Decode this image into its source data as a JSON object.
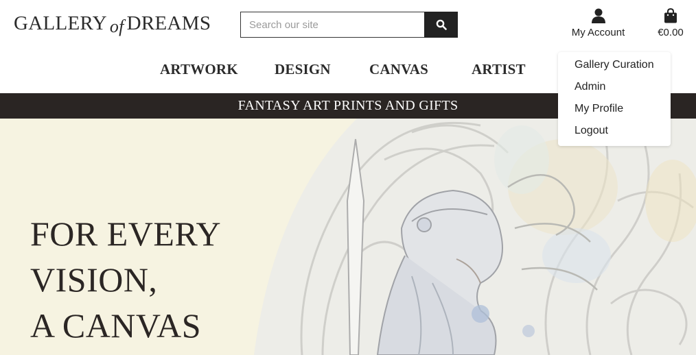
{
  "header": {
    "logo": {
      "left": "GALLERY",
      "middle": "of",
      "right": "DREAMS"
    },
    "search": {
      "placeholder": "Search our site",
      "value": ""
    },
    "account_label": "My Account",
    "bag_total": "€0.00"
  },
  "nav": {
    "items": [
      "ARTWORK",
      "DESIGN",
      "CANVAS",
      "ARTIST"
    ]
  },
  "banner": {
    "text": "FANTASY ART PRINTS AND GIFTS"
  },
  "hero": {
    "lines": [
      "FOR EVERY",
      "VISION,",
      "A CANVAS"
    ]
  },
  "account_menu": {
    "items": [
      "Gallery Curation",
      "Admin",
      "My Profile",
      "Logout"
    ]
  },
  "icons": {
    "search": "search-icon",
    "account": "user-icon",
    "bag": "shopping-bag-icon"
  },
  "colors": {
    "banner_bg": "#2a2523",
    "hero_bg": "#f6f3e1",
    "search_button": "#222222"
  }
}
